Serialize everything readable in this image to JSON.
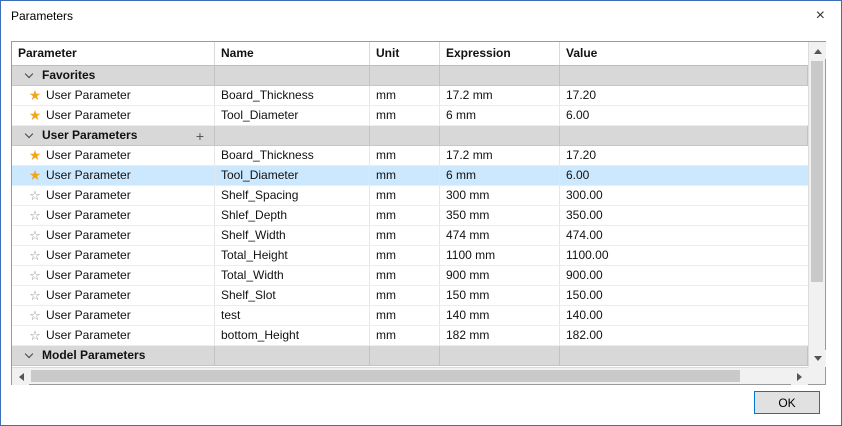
{
  "window": {
    "title": "Parameters",
    "close_icon": "×"
  },
  "table": {
    "columns": [
      "Parameter",
      "Name",
      "Unit",
      "Expression",
      "Value"
    ],
    "sections": [
      {
        "label": "Favorites",
        "has_add_button": false,
        "rows": [
          {
            "favorite": true,
            "type": "User Parameter",
            "name": "Board_Thickness",
            "unit": "mm",
            "expression": "17.2 mm",
            "value": "17.20",
            "selected": false
          },
          {
            "favorite": true,
            "type": "User Parameter",
            "name": "Tool_Diameter",
            "unit": "mm",
            "expression": "6 mm",
            "value": "6.00",
            "selected": false
          }
        ]
      },
      {
        "label": "User Parameters",
        "has_add_button": true,
        "rows": [
          {
            "favorite": true,
            "type": "User Parameter",
            "name": "Board_Thickness",
            "unit": "mm",
            "expression": "17.2 mm",
            "value": "17.20",
            "selected": false
          },
          {
            "favorite": true,
            "type": "User Parameter",
            "name": "Tool_Diameter",
            "unit": "mm",
            "expression": "6 mm",
            "value": "6.00",
            "selected": true
          },
          {
            "favorite": false,
            "type": "User Parameter",
            "name": "Shelf_Spacing",
            "unit": "mm",
            "expression": "300 mm",
            "value": "300.00",
            "selected": false
          },
          {
            "favorite": false,
            "type": "User Parameter",
            "name": "Shlef_Depth",
            "unit": "mm",
            "expression": "350 mm",
            "value": "350.00",
            "selected": false
          },
          {
            "favorite": false,
            "type": "User Parameter",
            "name": "Shelf_Width",
            "unit": "mm",
            "expression": "474 mm",
            "value": "474.00",
            "selected": false
          },
          {
            "favorite": false,
            "type": "User Parameter",
            "name": "Total_Height",
            "unit": "mm",
            "expression": "1100 mm",
            "value": "1100.00",
            "selected": false
          },
          {
            "favorite": false,
            "type": "User Parameter",
            "name": "Total_Width",
            "unit": "mm",
            "expression": "900 mm",
            "value": "900.00",
            "selected": false
          },
          {
            "favorite": false,
            "type": "User Parameter",
            "name": "Shelf_Slot",
            "unit": "mm",
            "expression": "150 mm",
            "value": "150.00",
            "selected": false
          },
          {
            "favorite": false,
            "type": "User Parameter",
            "name": "test",
            "unit": "mm",
            "expression": "140 mm",
            "value": "140.00",
            "selected": false
          },
          {
            "favorite": false,
            "type": "User Parameter",
            "name": "bottom_Height",
            "unit": "mm",
            "expression": "182 mm",
            "value": "182.00",
            "selected": false
          }
        ]
      },
      {
        "label": "Model Parameters",
        "has_add_button": false,
        "rows": []
      }
    ]
  },
  "footer": {
    "ok_label": "OK"
  },
  "colors": {
    "accent_border": "#3d6fb4",
    "selected_row": "#cbe8ff",
    "favorite_star": "#f2a71b",
    "section_bg": "#d8d8d8"
  }
}
